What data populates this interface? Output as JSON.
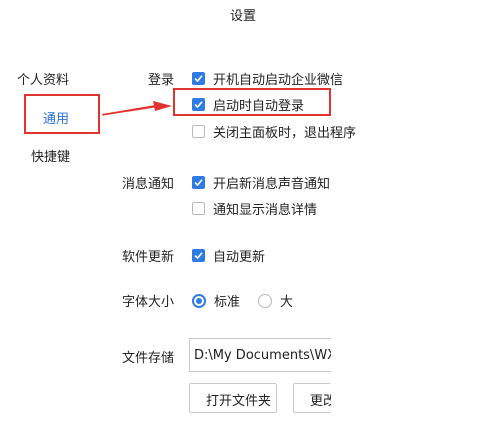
{
  "window": {
    "title": "设置"
  },
  "sidebar": {
    "items": [
      {
        "label": "个人资料"
      },
      {
        "label": "通用"
      },
      {
        "label": "快捷键"
      }
    ]
  },
  "login": {
    "label": "登录",
    "options": [
      {
        "label": "开机自动启动企业微信",
        "checked": true
      },
      {
        "label": "启动时自动登录",
        "checked": true
      },
      {
        "label": "关闭主面板时，退出程序",
        "checked": false
      }
    ]
  },
  "notifications": {
    "label": "消息通知",
    "options": [
      {
        "label": "开启新消息声音通知",
        "checked": true
      },
      {
        "label": "通知显示消息详情",
        "checked": false
      }
    ]
  },
  "updates": {
    "label": "软件更新",
    "option": {
      "label": "自动更新",
      "checked": true
    }
  },
  "font_size": {
    "label": "字体大小",
    "options": [
      {
        "label": "标准",
        "selected": true
      },
      {
        "label": "大",
        "selected": false
      }
    ]
  },
  "storage": {
    "label": "文件存储",
    "path": "D:\\My Documents\\WX",
    "open_button": "打开文件夹",
    "change_button": "更改"
  },
  "colors": {
    "accent": "#2f7be5",
    "highlight": "#e0322f"
  }
}
